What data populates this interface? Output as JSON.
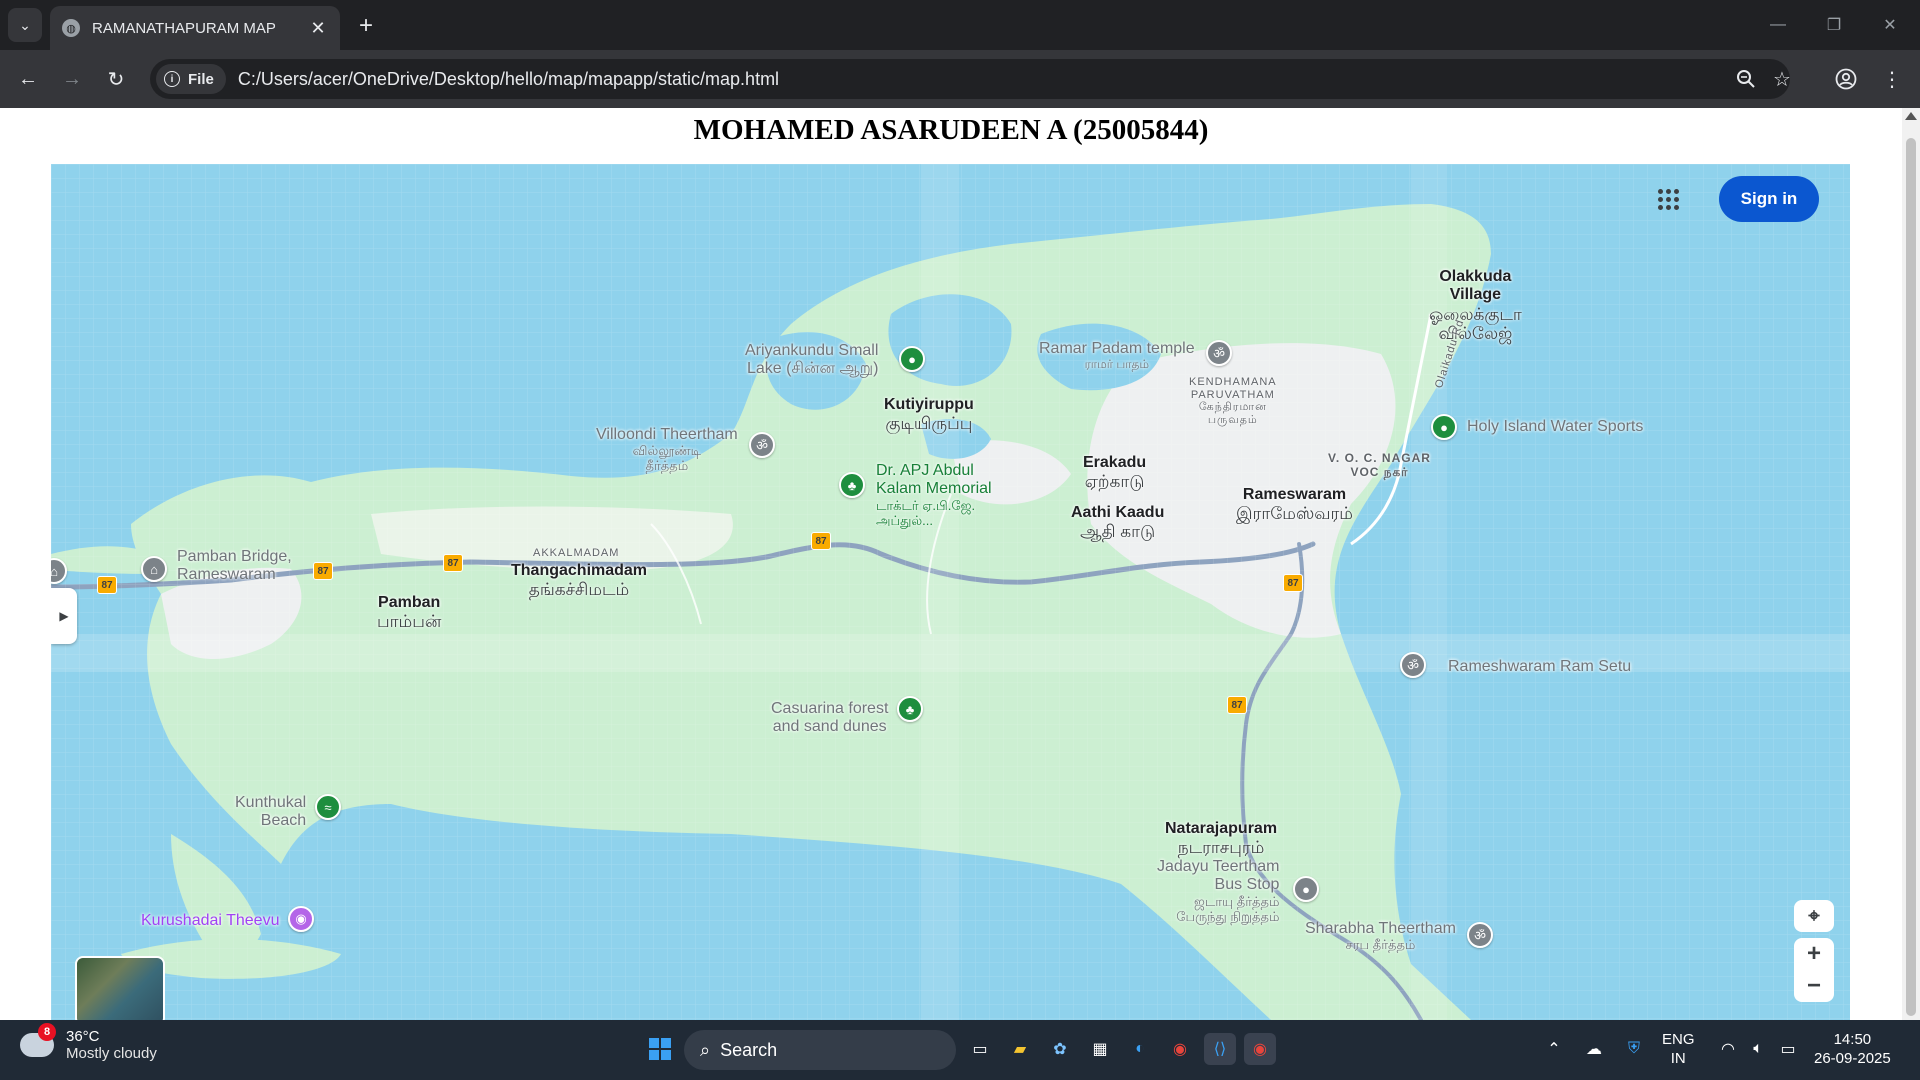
{
  "browser": {
    "tab_title": "RAMANATHAPURAM MAP",
    "tab_close": "✕",
    "new_tab": "+",
    "site_chip": "File",
    "url": "C:/Users/acer/OneDrive/Desktop/hello/map/mapapp/static/map.html"
  },
  "page": {
    "heading": "MOHAMED ASARUDEEN A (25005844)"
  },
  "map": {
    "sign_in": "Sign in",
    "route_shield": "87",
    "labels": {
      "olakkuda_en": "Olakkuda",
      "olakkuda_en2": "Village",
      "olakkuda_ta": "ஓலைக்குடா",
      "olakkuda_ta2": "வில்லேஜ்",
      "olaikadu_rd": "Olaikadu Rd",
      "ramar_padam": "Ramar Padam temple",
      "ramar_padam_ta": "ராமர் பாதம்",
      "kendhamana_1": "KENDHAMANA",
      "kendhamana_2": "PARUVATHAM",
      "kendhamana_ta1": "கேந்திரமான",
      "kendhamana_ta2": "பருவதம்",
      "ariyankundu_1": "Ariyankundu Small",
      "ariyankundu_2": "Lake (சின்ன ஆறு)",
      "kutiyiruppu": "Kutiyiruppu",
      "kutiyiruppu_ta": "குடியிருப்பு",
      "holy_island": "Holy Island Water Sports",
      "villoondi": "Villoondi Theertham",
      "villoondi_ta1": "வில்லூண்டி",
      "villoondi_ta2": "தீர்த்தம்",
      "voc_1": "V. O. C. NAGAR",
      "voc_2": "VOC நகர்",
      "apj_1": "Dr. APJ Abdul",
      "apj_2": "Kalam Memorial",
      "apj_ta1": "டாக்டர் ஏ.பி.ஜே.",
      "apj_ta2": "அப்துல்...",
      "erakadu": "Erakadu",
      "erakadu_ta": "ஏற்காடு",
      "rameswaram": "Rameswaram",
      "rameswaram_ta": "இராமேஸ்வரம்",
      "aathi_kaadu": "Aathi Kaadu",
      "aathi_kaadu_ta": "ஆதி காடு",
      "akkalmadam": "AKKALMADAM",
      "thangachimadam": "Thangachimadam",
      "thangachimadam_ta": "தங்கச்சிமடம்",
      "pamban_bridge_1": "Pamban Bridge,",
      "pamban_bridge_2": "Rameswaram",
      "pamban": "Pamban",
      "pamban_ta": "பாம்பன்",
      "ram_setu": "Rameshwaram Ram Setu",
      "casuarina_1": "Casuarina forest",
      "casuarina_2": "and sand dunes",
      "kunthukal_1": "Kunthukal",
      "kunthukal_2": "Beach",
      "natarajapuram": "Natarajapuram",
      "natarajapuram_ta": "நடராசபுரம்",
      "jadayu_1": "Jadayu Teertham",
      "jadayu_2": "Bus Stop",
      "jadayu_ta1": "ஜடாயு தீர்த்தம்",
      "jadayu_ta2": "பேருந்து நிறுத்தம்",
      "kurushadai": "Kurushadai Theevu",
      "sharabha": "Sharabha Theertham",
      "sharabha_ta": "சரப தீர்த்தம்"
    },
    "controls": {
      "zoom_in": "+",
      "zoom_out": "−"
    }
  },
  "taskbar": {
    "weather_badge": "8",
    "temperature": "36°C",
    "condition": "Mostly cloudy",
    "search_label": "Search",
    "language_1": "ENG",
    "language_2": "IN",
    "time": "14:50",
    "date": "26-09-2025"
  },
  "colors": {
    "water": "#8fd2ec",
    "land": "#ccefd2",
    "urban": "#eef0f1",
    "sign_in": "#0b57d0",
    "poi_green": "#1e8e3e"
  }
}
